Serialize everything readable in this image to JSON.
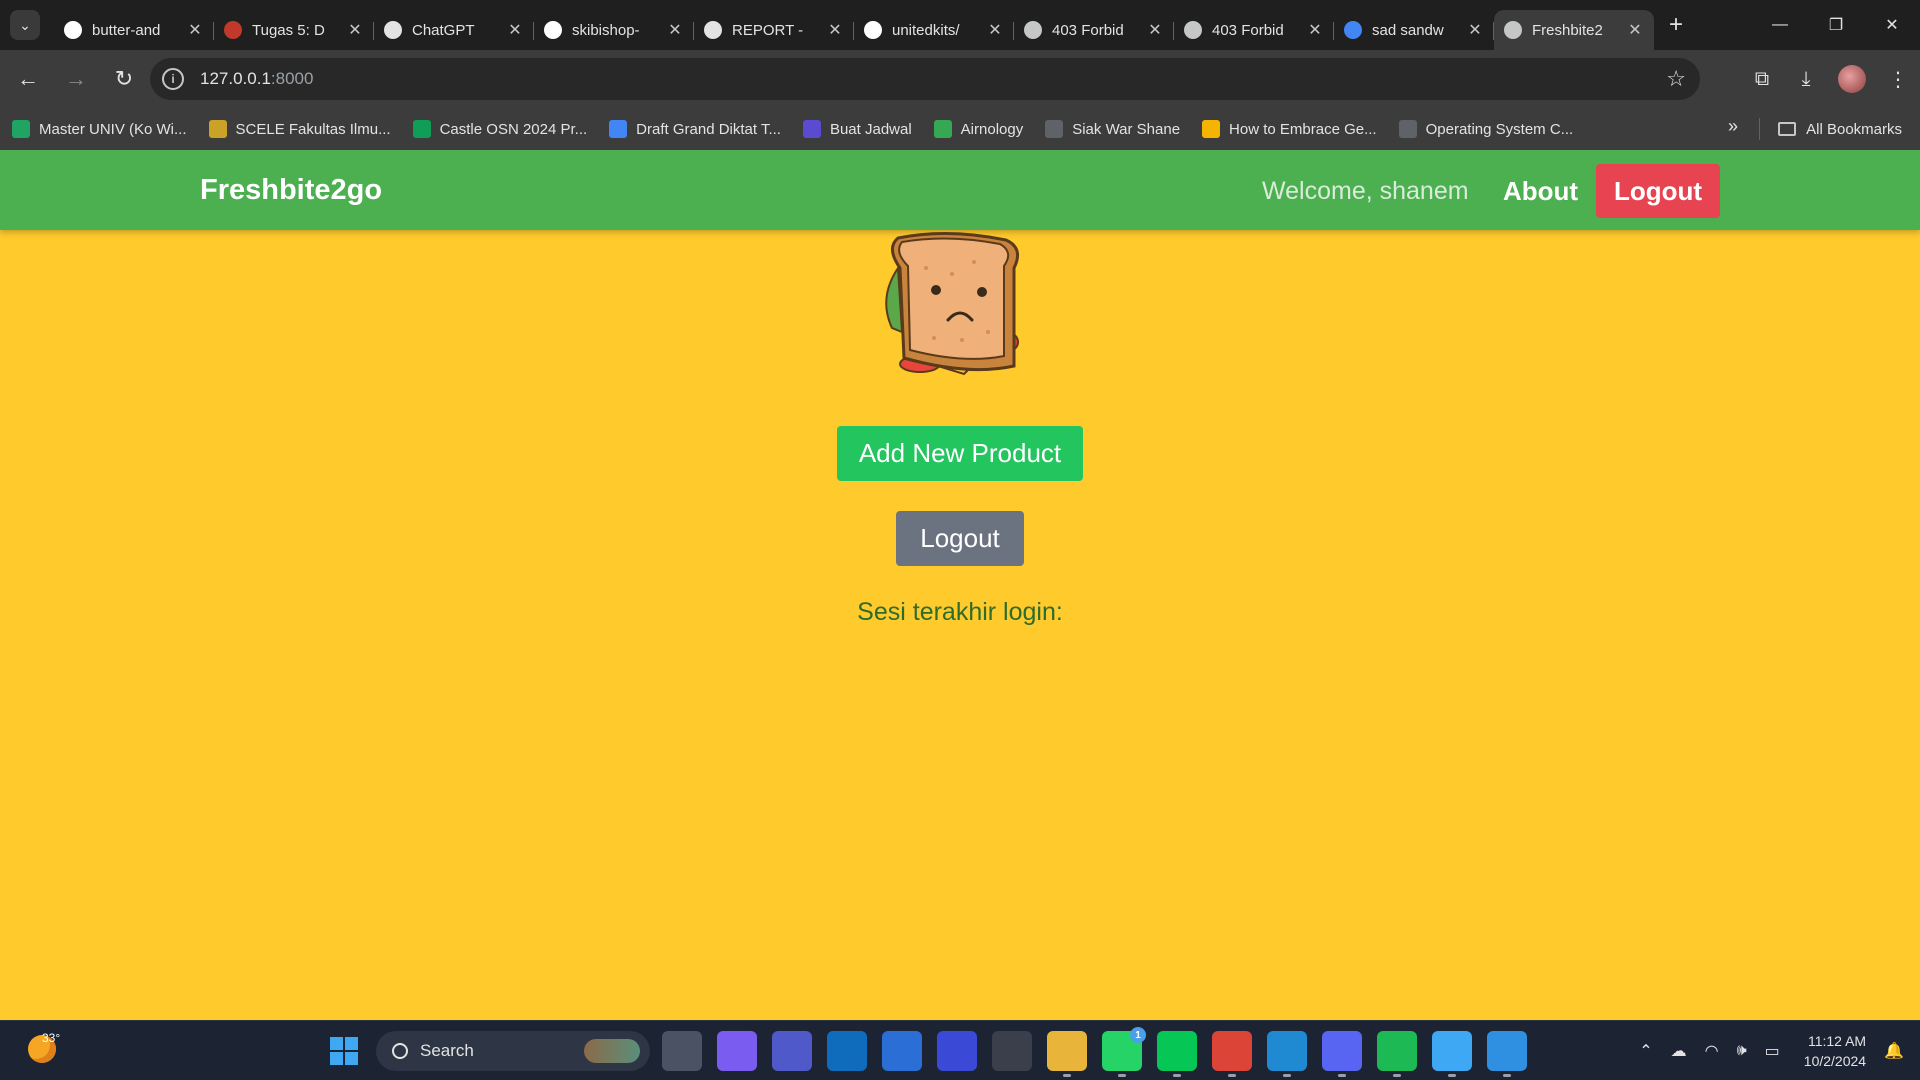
{
  "browser": {
    "tabs": [
      {
        "title": "butter-and",
        "icon": "github-icon",
        "color": "#ffffff"
      },
      {
        "title": "Tugas 5: D",
        "icon": "tugas-icon",
        "color": "#c0392b"
      },
      {
        "title": "ChatGPT",
        "icon": "chatgpt-icon",
        "color": "#e3e3e3"
      },
      {
        "title": "skibishop-",
        "icon": "github-icon",
        "color": "#ffffff"
      },
      {
        "title": "REPORT - ",
        "icon": "report-icon",
        "color": "#e3e3e3"
      },
      {
        "title": "unitedkits/",
        "icon": "github-icon",
        "color": "#ffffff"
      },
      {
        "title": "403 Forbid",
        "icon": "globe-icon",
        "color": "#c4c7c5"
      },
      {
        "title": "403 Forbid",
        "icon": "globe-icon",
        "color": "#c4c7c5"
      },
      {
        "title": "sad sandw",
        "icon": "google-icon",
        "color": "#4285f4"
      },
      {
        "title": "Freshbite2",
        "icon": "globe-icon",
        "color": "#c4c7c5",
        "active": true
      }
    ],
    "url_host": "127.0.0.1",
    "url_port": ":8000",
    "bookmarks": [
      {
        "label": "Master UNIV (Ko Wi...",
        "icon": "drive-icon",
        "color": "#1fa463"
      },
      {
        "label": "SCELE Fakultas Ilmu...",
        "icon": "scele-icon",
        "color": "#c9a227"
      },
      {
        "label": "Castle OSN 2024 Pr...",
        "icon": "sheets-icon",
        "color": "#0f9d58"
      },
      {
        "label": "Draft Grand Diktat T...",
        "icon": "docs-icon",
        "color": "#4285f4"
      },
      {
        "label": "Buat Jadwal",
        "icon": "r-icon",
        "color": "#5b4bd1"
      },
      {
        "label": "Airnology",
        "icon": "airnology-icon",
        "color": "#34a853"
      },
      {
        "label": "Siak War Shane",
        "icon": "globe-icon",
        "color": "#5f6368"
      },
      {
        "label": "How to Embrace Ge...",
        "icon": "slides-icon",
        "color": "#f4b400"
      },
      {
        "label": "Operating System C...",
        "icon": "globe-icon",
        "color": "#5f6368"
      }
    ],
    "all_bookmarks": "All Bookmarks"
  },
  "page": {
    "brand": "Freshbite2go",
    "welcome": "Welcome, shanem",
    "about": "About",
    "nav_logout": "Logout",
    "add_product": "Add New Product",
    "logout": "Logout",
    "last_login": "Sesi terakhir login:",
    "colors": {
      "navbar": "#4caf50",
      "background": "#ffca2c",
      "danger": "#e84350",
      "success": "#22c55e",
      "secondary": "#6b7280"
    }
  },
  "taskbar": {
    "temperature": "33°",
    "search": "Search",
    "apps": [
      {
        "name": "task-view-icon",
        "color": "#4b5263"
      },
      {
        "name": "copilot-icon",
        "color": "#7a5cf0"
      },
      {
        "name": "teams-icon",
        "color": "#5059c9"
      },
      {
        "name": "outlook-icon",
        "color": "#0f6cbd"
      },
      {
        "name": "store-icon",
        "color": "#2b6fd6"
      },
      {
        "name": "app-m-icon",
        "color": "#3b4ad6"
      },
      {
        "name": "unity-icon",
        "color": "#3a3f4b"
      },
      {
        "name": "file-explorer-icon",
        "color": "#e8b53a"
      },
      {
        "name": "whatsapp-icon",
        "color": "#25d366",
        "badge": "1"
      },
      {
        "name": "line-icon",
        "color": "#06c755"
      },
      {
        "name": "chrome-icon",
        "color": "#db4437"
      },
      {
        "name": "vscode-icon",
        "color": "#1f8ad2"
      },
      {
        "name": "discord-icon",
        "color": "#5865f2"
      },
      {
        "name": "spotify-icon",
        "color": "#1db954"
      },
      {
        "name": "notepad-icon",
        "color": "#3fa8f4"
      },
      {
        "name": "photos-icon",
        "color": "#2f8fe0"
      }
    ],
    "time": "11:12 AM",
    "date": "10/2/2024"
  }
}
